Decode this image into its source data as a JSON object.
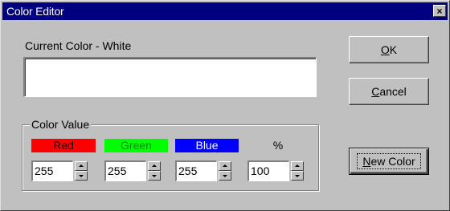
{
  "window": {
    "title": "Color Editor",
    "close_glyph": "×"
  },
  "current_color": {
    "label": "Current Color - White",
    "swatch_color": "#ffffff"
  },
  "buttons": {
    "ok_prefix": "O",
    "ok_rest": "K",
    "cancel_prefix": "C",
    "cancel_rest": "ancel",
    "new_color_prefix": "N",
    "new_color_rest": "ew Color"
  },
  "color_value": {
    "group_label": "Color Value",
    "channels": [
      {
        "label": "Red",
        "value": "255",
        "color": "#ff0000"
      },
      {
        "label": "Green",
        "value": "255",
        "color": "#00ff00"
      },
      {
        "label": "Blue",
        "value": "255",
        "color": "#0000ff"
      },
      {
        "label": "%",
        "value": "100",
        "color": ""
      }
    ]
  }
}
